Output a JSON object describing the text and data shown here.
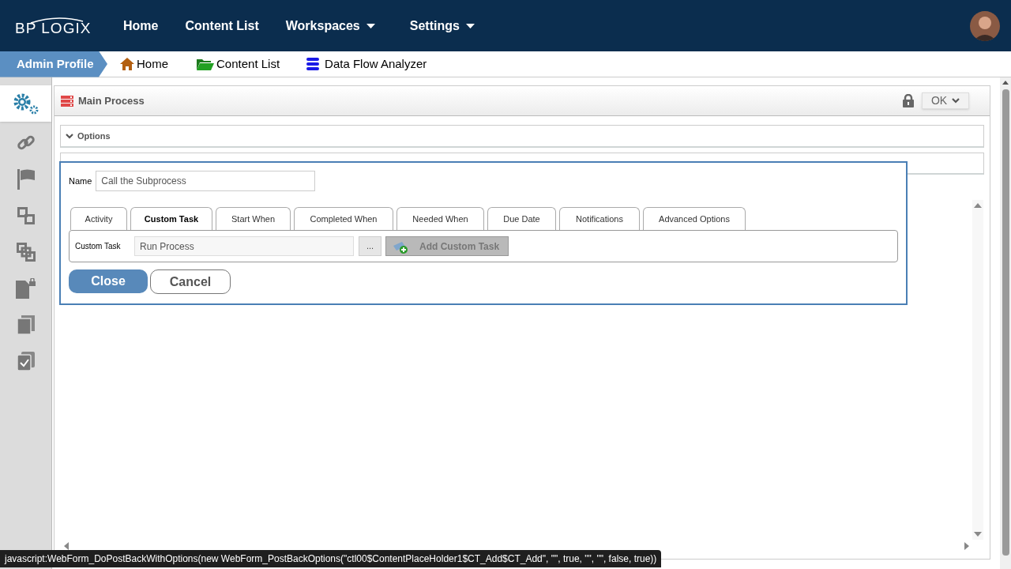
{
  "logo": "BP LOGIX",
  "nav": [
    {
      "label": "Home",
      "dropdown": false
    },
    {
      "label": "Content List",
      "dropdown": false
    },
    {
      "label": "Workspaces",
      "dropdown": true
    },
    {
      "label": "Settings",
      "dropdown": true
    }
  ],
  "breadcrumb": {
    "profile": "Admin Profile",
    "links": [
      {
        "label": "Home"
      },
      {
        "label": "Content List"
      },
      {
        "label": "Data Flow Analyzer"
      }
    ]
  },
  "sidebar": {
    "items": [
      {
        "selected": true
      },
      {
        "selected": false
      },
      {
        "selected": false
      },
      {
        "selected": false
      },
      {
        "selected": false
      },
      {
        "selected": false
      },
      {
        "selected": false
      },
      {
        "selected": false
      }
    ]
  },
  "panel": {
    "title": "Main Process",
    "ok_button": "OK",
    "sections": [
      "Options"
    ]
  },
  "dialog": {
    "name_label": "Name",
    "name_value": "Call the Subprocess",
    "tabs": [
      {
        "label": "Activity",
        "selected": false
      },
      {
        "label": "Custom Task",
        "selected": true
      },
      {
        "label": "Start When",
        "selected": false
      },
      {
        "label": "Completed When",
        "selected": false
      },
      {
        "label": "Needed When",
        "selected": false
      },
      {
        "label": "Due Date",
        "selected": false
      },
      {
        "label": "Notifications",
        "selected": false
      },
      {
        "label": "Advanced Options",
        "selected": false
      }
    ],
    "custom_task_label": "Custom Task",
    "custom_task_value": "Run Process",
    "browse_button": "...",
    "add_button": "Add Custom Task",
    "add_disabled": true,
    "close_button": "Close",
    "cancel_button": "Cancel"
  },
  "status_text": "javascript:WebForm_DoPostBackWithOptions(new WebForm_PostBackOptions(\"ctl00$ContentPlaceHolder1$CT_Add$CT_Add\", \"\", true, \"\", \"\", false, true))"
}
